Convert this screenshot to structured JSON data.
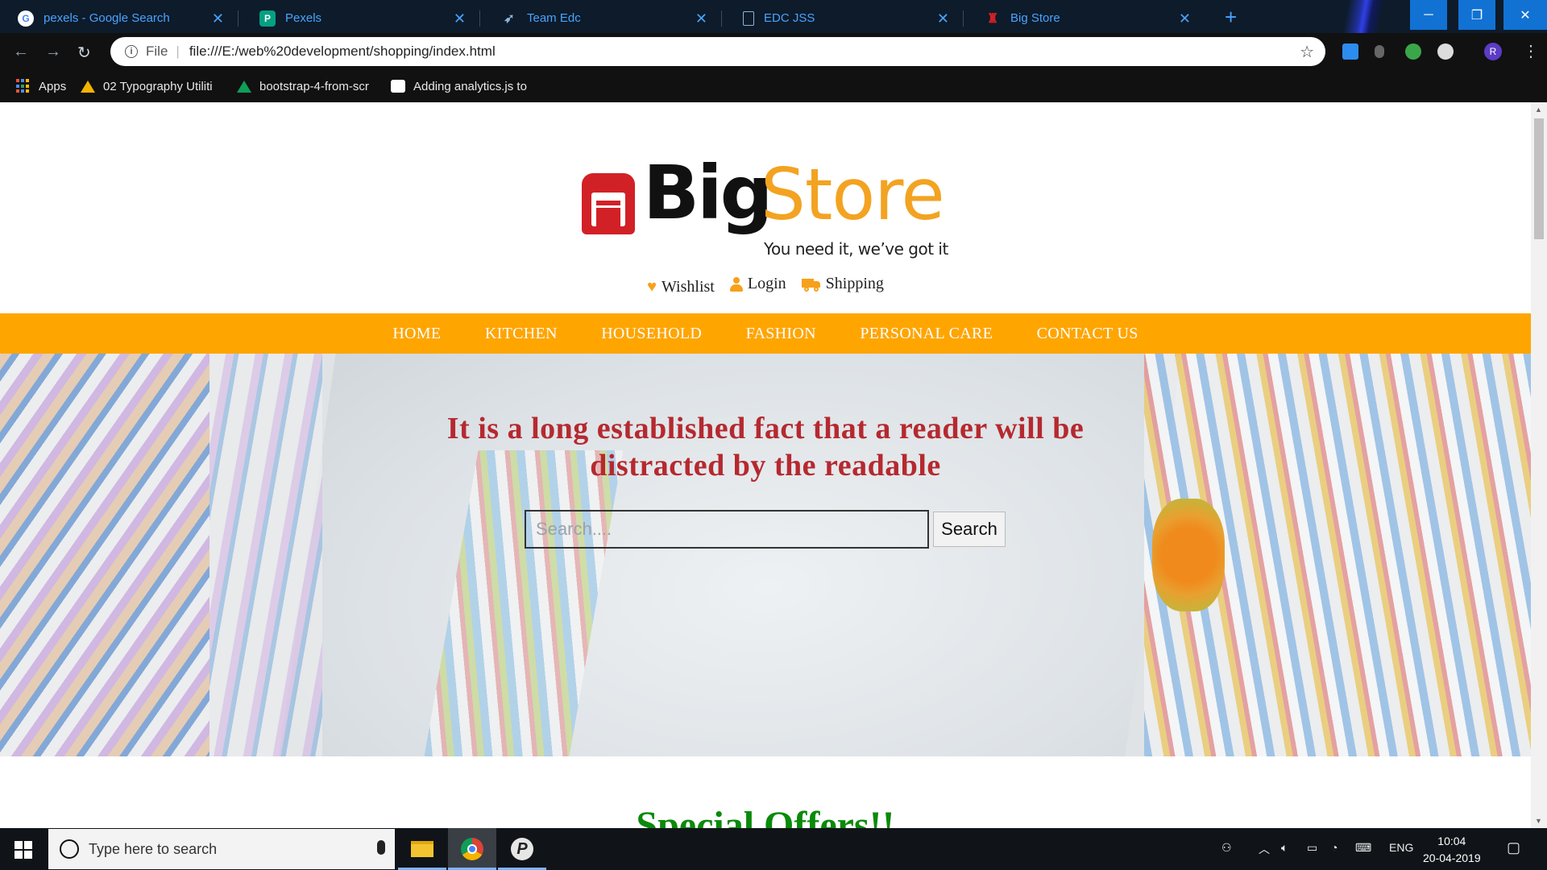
{
  "browser": {
    "tabs": [
      {
        "title": "pexels - Google Search",
        "icon": "google-icon"
      },
      {
        "title": "Pexels",
        "icon": "pexels-icon"
      },
      {
        "title": "Team Edc",
        "icon": "rocket-icon"
      },
      {
        "title": "EDC JSS",
        "icon": "document-icon"
      },
      {
        "title": "Big Store",
        "icon": "bigstore-icon"
      }
    ],
    "address": {
      "scheme_label": "File",
      "url": "file:///E:/web%20development/shopping/index.html"
    },
    "bookmarks": [
      {
        "label": "Apps",
        "icon": "apps-grid-icon"
      },
      {
        "label": "02 Typography Utiliti",
        "icon": "google-drive-icon"
      },
      {
        "label": "bootstrap-4-from-scr",
        "icon": "google-drive-icon"
      },
      {
        "label": "Adding analytics.js to",
        "icon": "analytics-icon"
      }
    ],
    "profile_initial": "R"
  },
  "site": {
    "logo": {
      "big": "Big",
      "store": "Store",
      "tagline": "You need it, we’ve got it"
    },
    "quick_links": [
      {
        "label": "Wishlist",
        "icon": "heart-icon"
      },
      {
        "label": "Login",
        "icon": "user-icon"
      },
      {
        "label": "Shipping",
        "icon": "truck-icon"
      }
    ],
    "nav": [
      "HOME",
      "KITCHEN",
      "HOUSEHOLD",
      "FASHION",
      "PERSONAL CARE",
      "CONTACT US"
    ],
    "hero": {
      "headline_line1": "It is a long established fact that a reader will be",
      "headline_line2": "distracted by the readable",
      "search_placeholder": "Search....",
      "search_button": "Search"
    },
    "special_heading": "Special Offers!!",
    "colors": {
      "nav_bg": "#ffa500",
      "headline": "#b5292f",
      "logo_orange": "#f3a321",
      "logo_red": "#d22027",
      "special": "#0a8a0a"
    }
  },
  "taskbar": {
    "search_placeholder": "Type here to search",
    "language": "ENG",
    "time": "10:04",
    "date": "20-04-2019"
  }
}
